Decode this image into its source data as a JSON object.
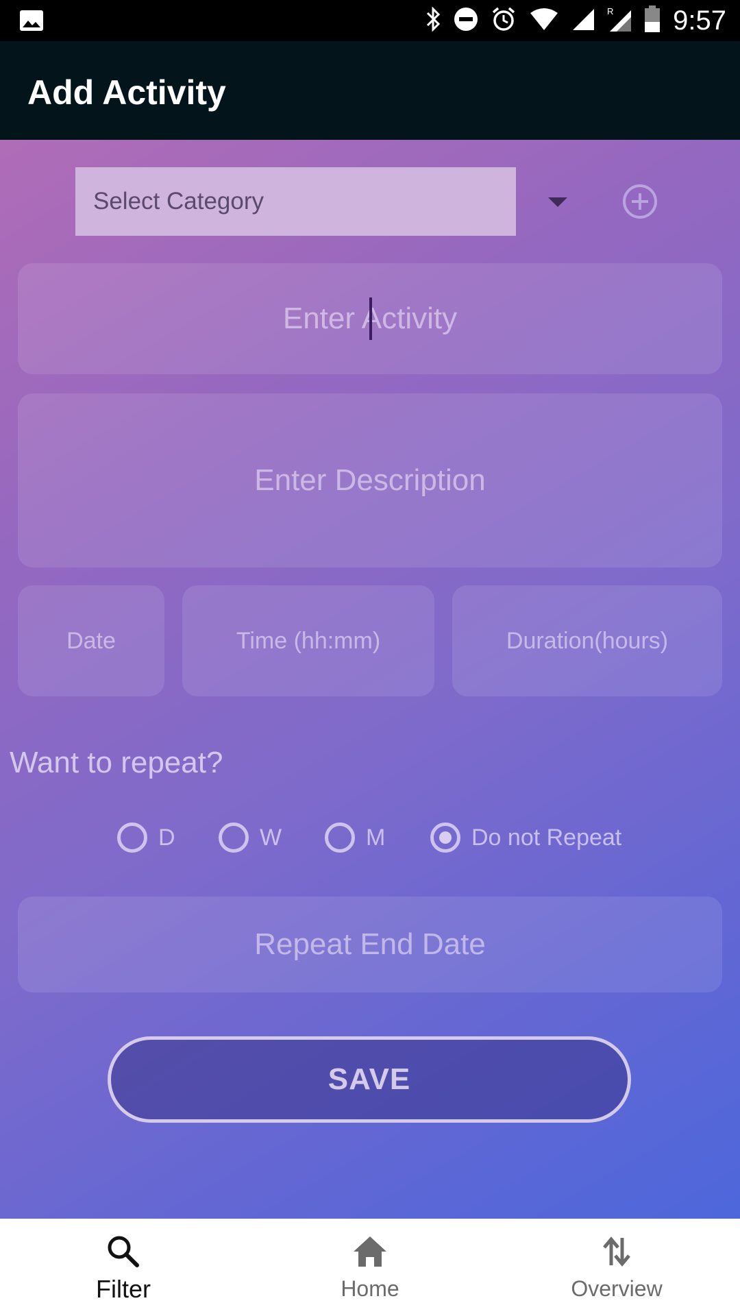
{
  "status_bar": {
    "time": "9:57",
    "icons": [
      "image-icon",
      "bluetooth-icon",
      "do-not-disturb-icon",
      "alarm-icon",
      "wifi-icon",
      "signal-icon",
      "roaming-signal-icon",
      "battery-icon"
    ]
  },
  "app_bar": {
    "title": "Add Activity"
  },
  "form": {
    "category": {
      "value": "Select Category",
      "add_icon": "add-circle-icon"
    },
    "activity": {
      "placeholder": "Enter Activity"
    },
    "description": {
      "placeholder": "Enter Description"
    },
    "date": {
      "placeholder": "Date"
    },
    "time": {
      "placeholder": "Time (hh:mm)"
    },
    "duration": {
      "placeholder": "Duration(hours)"
    },
    "repeat_question": "Want to repeat?",
    "repeat_options": [
      {
        "label": "D",
        "checked": false
      },
      {
        "label": "W",
        "checked": false
      },
      {
        "label": "M",
        "checked": false
      },
      {
        "label": "Do not Repeat",
        "checked": true
      }
    ],
    "repeat_end_date": {
      "placeholder": "Repeat End Date"
    },
    "save_label": "SAVE"
  },
  "bottom_nav": {
    "items": [
      {
        "label": "Filter",
        "icon": "search-icon",
        "active": true
      },
      {
        "label": "Home",
        "icon": "home-icon",
        "active": false
      },
      {
        "label": "Overview",
        "icon": "swap-vertical-icon",
        "active": false
      }
    ]
  },
  "colors": {
    "app_bar": "#03151b",
    "gradient_start": "#b06cb7",
    "gradient_end": "#4d67db",
    "category_bg": "#cfb4dd"
  }
}
